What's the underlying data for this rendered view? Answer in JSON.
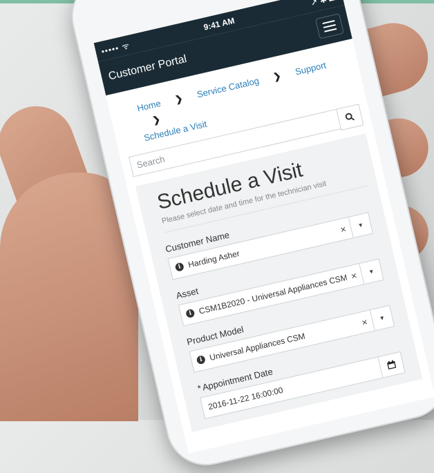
{
  "status_bar": {
    "signal": "••••• ᯤ",
    "time": "9:41 AM",
    "battery": "➚ ✱ ▬"
  },
  "app_bar": {
    "title": "Customer Portal"
  },
  "breadcrumb": {
    "items": [
      "Home",
      "Service Catalog",
      "Support",
      "Schedule a Visit"
    ],
    "separator": "❯"
  },
  "search": {
    "placeholder": "Search"
  },
  "form": {
    "title": "Schedule a Visit",
    "subtitle": "Please select date and time for the technician visit",
    "fields": {
      "customer_name": {
        "label": "Customer Name",
        "value": "Harding Asher"
      },
      "asset": {
        "label": "Asset",
        "value": "CSM1B2020 - Universal Appliances CSM"
      },
      "product_model": {
        "label": "Product Model",
        "value": "Universal Appliances CSM"
      },
      "appointment_date": {
        "label": "Appointment Date",
        "required_mark": "*",
        "value": "2016-11-22 16:00:00"
      }
    }
  },
  "glyphs": {
    "clear": "×",
    "dropdown": "▾",
    "info": "i"
  },
  "colors": {
    "header_bg": "#1a2b35",
    "link": "#2a7fb8",
    "accent_bar": "#7fbfa4"
  }
}
